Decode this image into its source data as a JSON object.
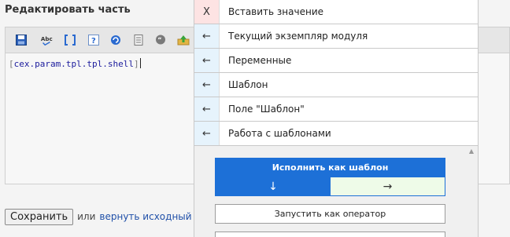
{
  "editor": {
    "title": "Редактировать часть",
    "code": {
      "open_bracket": "[",
      "expression": "cex.param.tpl.tpl.shell",
      "close_bracket": "]"
    },
    "toolbar": [
      {
        "name": "save-icon"
      },
      {
        "name": "spellcheck-icon",
        "text": "Abc"
      },
      {
        "name": "brackets-icon",
        "text": "[]"
      },
      {
        "name": "help-icon",
        "text": "?"
      },
      {
        "name": "refresh-icon"
      },
      {
        "name": "document-icon"
      },
      {
        "name": "comment-icon"
      },
      {
        "name": "upload-icon"
      }
    ],
    "save_label": "Сохранить",
    "or_text": "или",
    "revert_label": "вернуть исходный те"
  },
  "popup": {
    "items": [
      {
        "icon": "X",
        "icon_name": "close-icon",
        "label": "Вставить значение"
      },
      {
        "icon": "←",
        "icon_name": "back-arrow-icon",
        "label": "Текущий экземпляр модуля"
      },
      {
        "icon": "←",
        "icon_name": "back-arrow-icon",
        "label": "Переменные"
      },
      {
        "icon": "←",
        "icon_name": "back-arrow-icon",
        "label": "Шаблон"
      },
      {
        "icon": "←",
        "icon_name": "back-arrow-icon",
        "label": "Поле \"Шаблон\""
      },
      {
        "icon": "←",
        "icon_name": "back-arrow-icon",
        "label": "Работа с шаблонами"
      }
    ],
    "scroll_up": "▲",
    "execute_template_label": "Исполнить как шаблон",
    "arrow_down": "↓",
    "arrow_right": "→",
    "run_operator_label": "Запустить как оператор"
  },
  "colors": {
    "accent": "#1d70d7",
    "close_bg": "#fde3e3",
    "back_bg": "#e6f3fc",
    "arrow_right_bg": "#eefbe8",
    "link": "#1f4fa8"
  }
}
